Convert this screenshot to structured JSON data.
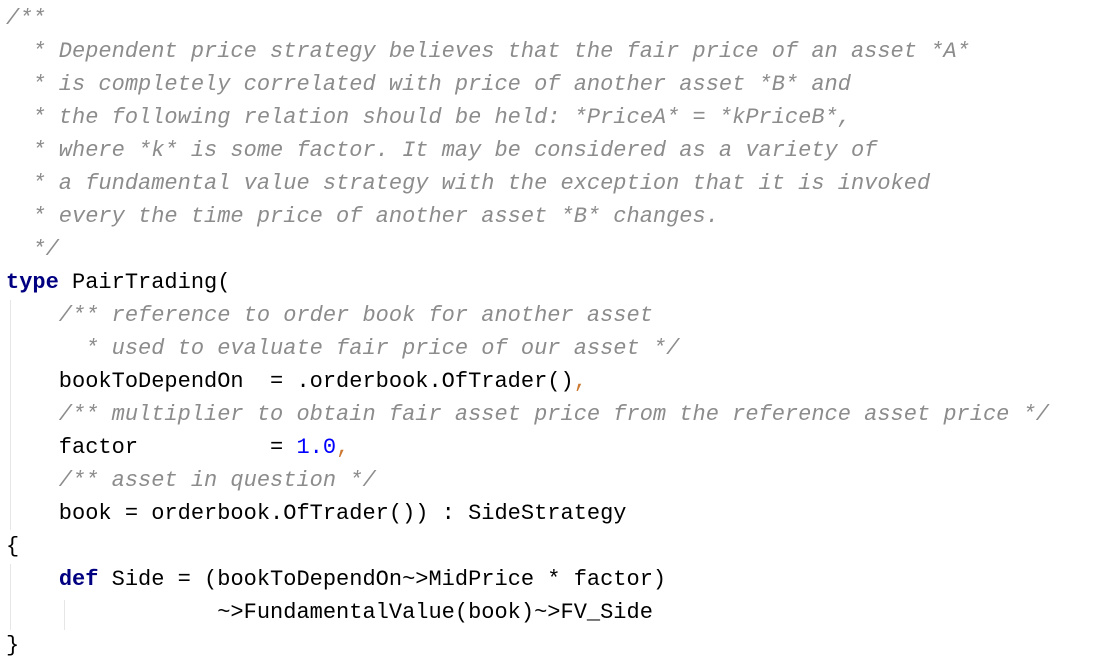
{
  "lines": [
    {
      "text": "/**"
    },
    {
      "text": "  * Dependent price strategy believes that the fair price of an asset *A*"
    },
    {
      "text": "  * is completely correlated with price of another asset *B* and"
    },
    {
      "text": "  * the following relation should be held: *PriceA* = *kPriceB*,"
    },
    {
      "text": "  * where *k* is some factor. It may be considered as a variety of"
    },
    {
      "text": "  * a fundamental value strategy with the exception that it is invoked"
    },
    {
      "text": "  * every the time price of another asset *B* changes."
    },
    {
      "text": "  */"
    },
    {
      "kw": "type",
      "rest": " PairTrading("
    },
    {
      "text": "    /** reference to order book for another asset"
    },
    {
      "text": "      * used to evaluate fair price of our asset */"
    },
    {
      "code": "    bookToDependOn  = .orderbook.OfTrader()",
      "suffix": ","
    },
    {
      "text": "    /** multiplier to obtain fair asset price from the reference asset price */"
    },
    {
      "pre": "    factor          = ",
      "num": "1.0",
      "suffix": ","
    },
    {
      "text": "    /** asset in question */"
    },
    {
      "code": "    book = orderbook.OfTrader()) : SideStrategy"
    },
    {
      "code": "{"
    },
    {
      "indent": "    ",
      "kw": "def",
      "rest": " Side = (bookToDependOn~>MidPrice * factor)"
    },
    {
      "code": "                ~>FundamentalValue(book)~>FV_Side"
    },
    {
      "code": "}"
    }
  ]
}
